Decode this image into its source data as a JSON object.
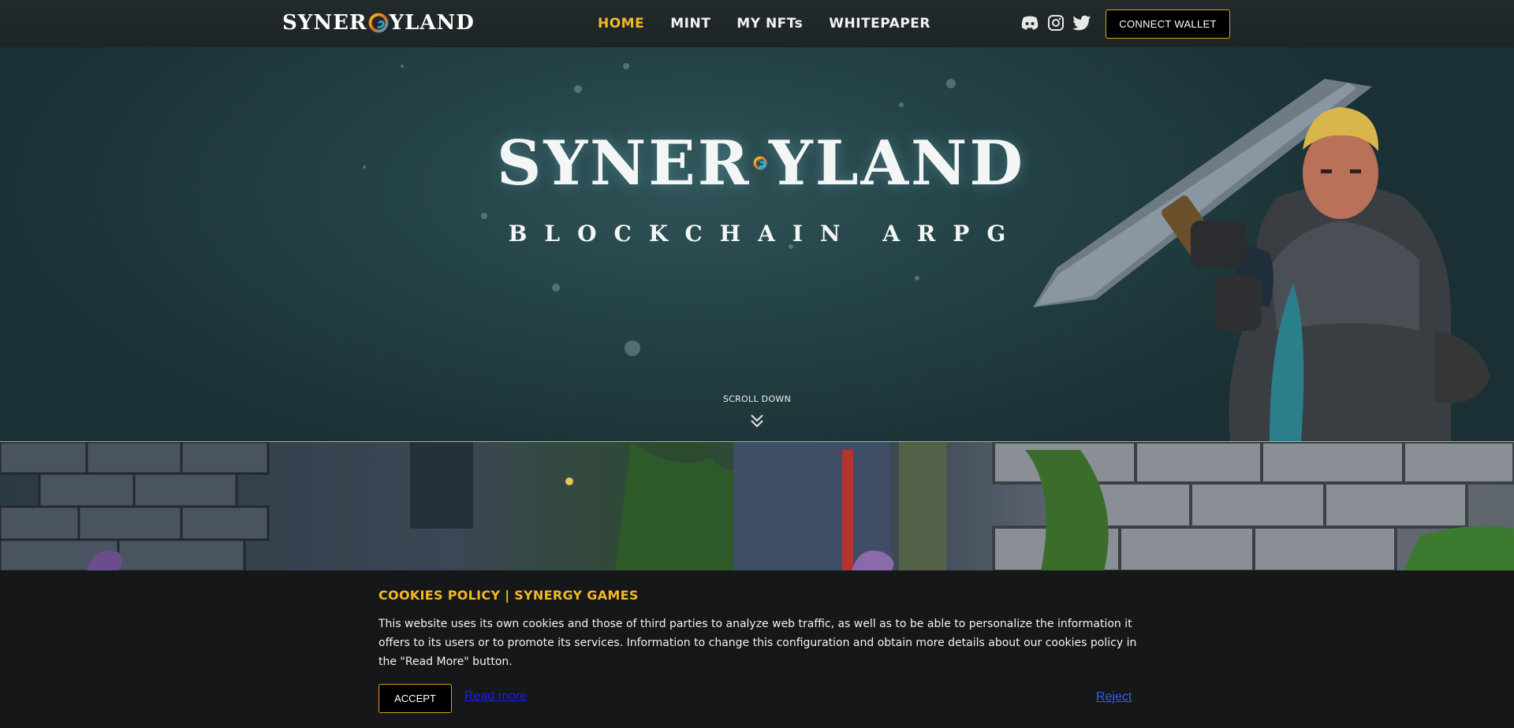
{
  "header": {
    "brand": {
      "left": "SYNER",
      "right": "YLAND",
      "icon": "synergy-swirl-icon"
    },
    "nav": [
      {
        "label": "HOME",
        "active": true
      },
      {
        "label": "MINT",
        "active": false
      },
      {
        "label": "MY NFTs",
        "active": false
      },
      {
        "label": "WHITEPAPER",
        "active": false
      }
    ],
    "socials": [
      {
        "name": "discord-icon"
      },
      {
        "name": "instagram-icon"
      },
      {
        "name": "twitter-icon"
      }
    ],
    "wallet_label": "CONNECT WALLET"
  },
  "hero": {
    "logo": {
      "left": "SYNER",
      "right": "YLAND"
    },
    "tagline": "BLOCKCHAIN ARPG",
    "scroll_label": "SCROLL DOWN"
  },
  "cookies": {
    "title": "COOKIES POLICY | SYNERGY GAMES",
    "text": "This website uses its own cookies and those of third parties to analyze web traffic, as well as to be able to personalize the information it offers to its users or to promote its services. Information to change this configuration and obtain more details about our cookies policy in the \"Read More\" button.",
    "accept_label": "ACCEPT",
    "read_more_label": "Read more",
    "reject_label": "Reject"
  },
  "colors": {
    "accent": "#f3b826",
    "border_gold": "#d9a521",
    "hero_bg": "#244246"
  }
}
